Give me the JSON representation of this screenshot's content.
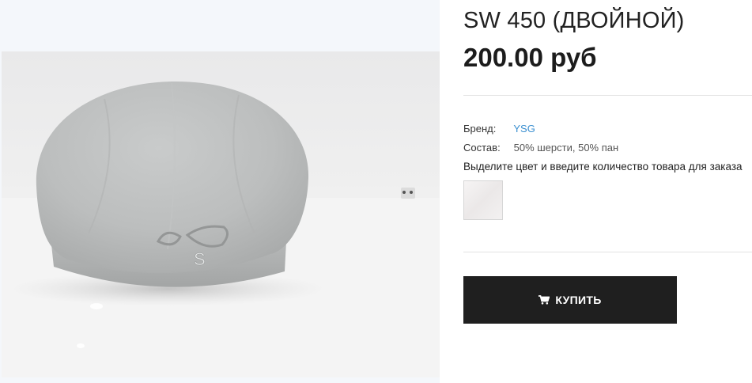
{
  "product": {
    "title": "SW 450 (ДВОЙНОЙ)",
    "price": "200.00 руб",
    "image_alt_icon": "beret-photo",
    "brand_label": "Бренд:",
    "brand_value": "YSG",
    "composition_label": "Состав:",
    "composition_value": "50% шерсти, 50% пан",
    "instruction": "Выделите цвет и введите количество товара для заказа",
    "swatch_color": "#f0eded"
  },
  "actions": {
    "buy_label": "КУПИТЬ",
    "buy_icon": "cart-icon"
  },
  "colors": {
    "button_bg": "#1f1f1f",
    "link": "#3a8fd0",
    "text": "#222222"
  }
}
